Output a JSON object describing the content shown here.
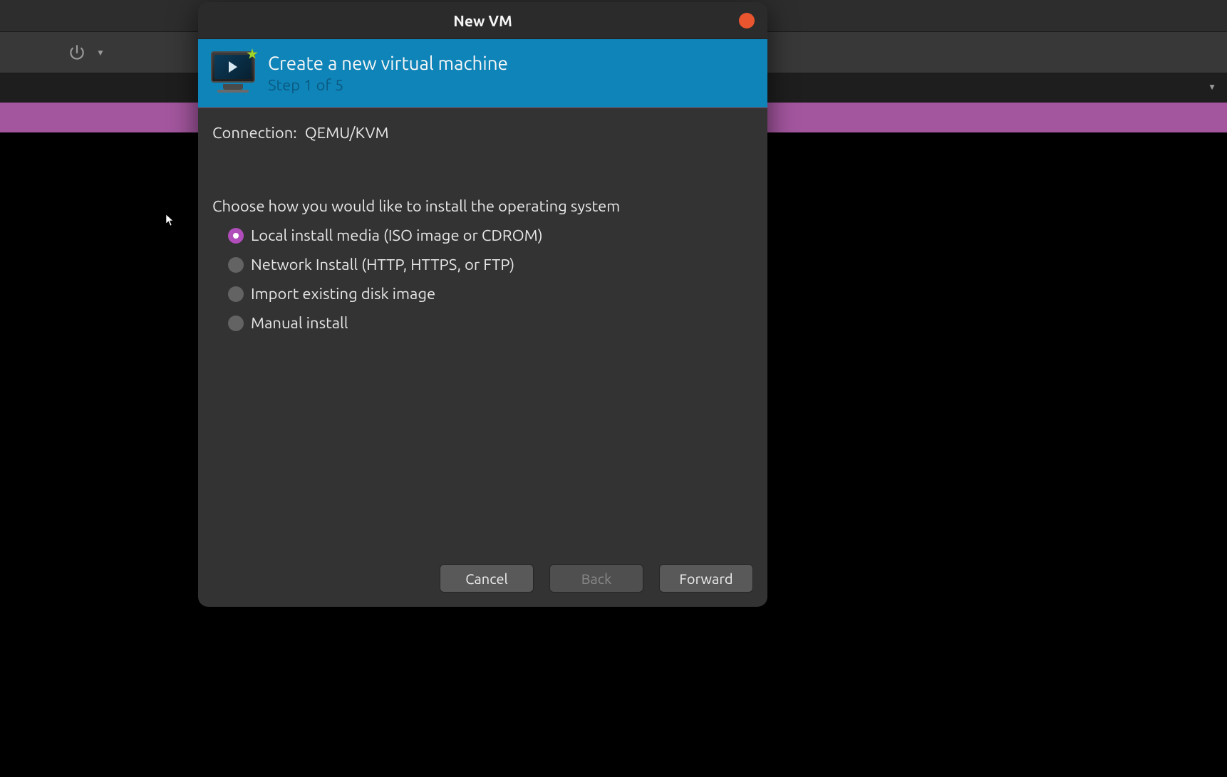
{
  "dialog": {
    "title": "New VM",
    "wizard_title": "Create a new virtual machine",
    "step_label": "Step 1 of 5",
    "connection_label": "Connection:",
    "connection_value": "QEMU/KVM",
    "choose_label": "Choose how you would like to install the operating system",
    "options": [
      {
        "label": "Local install media (ISO image or CDROM)",
        "selected": true
      },
      {
        "label": "Network Install (HTTP, HTTPS, or FTP)",
        "selected": false
      },
      {
        "label": "Import existing disk image",
        "selected": false
      },
      {
        "label": "Manual install",
        "selected": false
      }
    ],
    "buttons": {
      "cancel": "Cancel",
      "back": "Back",
      "forward": "Forward"
    }
  }
}
